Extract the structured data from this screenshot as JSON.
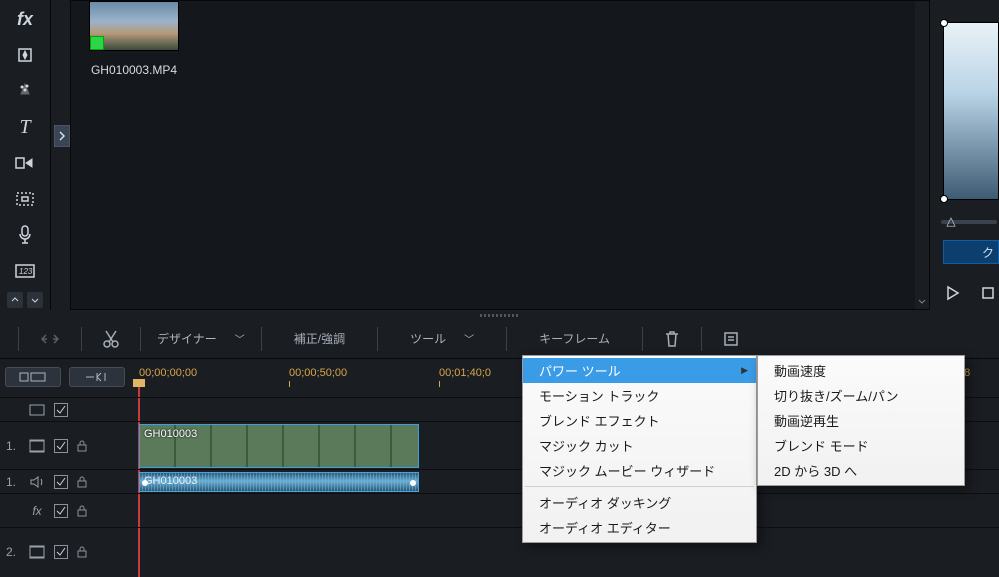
{
  "tools_strip": {
    "items": [
      "fx",
      "sparkle",
      "brush",
      "text",
      "flash",
      "frame",
      "mic",
      "counter"
    ]
  },
  "media": {
    "clip_name": "GH010003.MP4"
  },
  "preview": {
    "button_label": "ク"
  },
  "toolbar": {
    "designer": "デザイナー",
    "fix_enhance": "補正/強調",
    "tools": "ツール",
    "keyframe": "キーフレーム"
  },
  "ruler": {
    "marks": [
      {
        "pos": 4,
        "label": "00;00;00;00"
      },
      {
        "pos": 154,
        "label": "00;00;50;00"
      },
      {
        "pos": 304,
        "label": "00;01;40;0"
      },
      {
        "pos": 820,
        "label": ";08"
      }
    ]
  },
  "tracks": {
    "opts_row": {
      "num": ""
    },
    "v1": {
      "num": "1."
    },
    "a1": {
      "num": "1."
    },
    "fx": {
      "num": ""
    },
    "v2": {
      "num": "2."
    }
  },
  "clip": {
    "video_label": "GH010003",
    "audio_label": "GH010003"
  },
  "menu1": {
    "power_tool": "パワー ツール",
    "motion_track": "モーション トラック",
    "blend_effect": "ブレンド エフェクト",
    "magic_cut": "マジック カット",
    "magic_movie": "マジック ムービー ウィザード",
    "audio_ducking": "オーディオ ダッキング",
    "audio_editor": "オーディオ エディター"
  },
  "menu2": {
    "video_speed": "動画速度",
    "crop_zoom_pan": "切り抜き/ズーム/パン",
    "reverse": "動画逆再生",
    "blend_mode": "ブレンド モード",
    "to3d": "2D から 3D へ"
  }
}
